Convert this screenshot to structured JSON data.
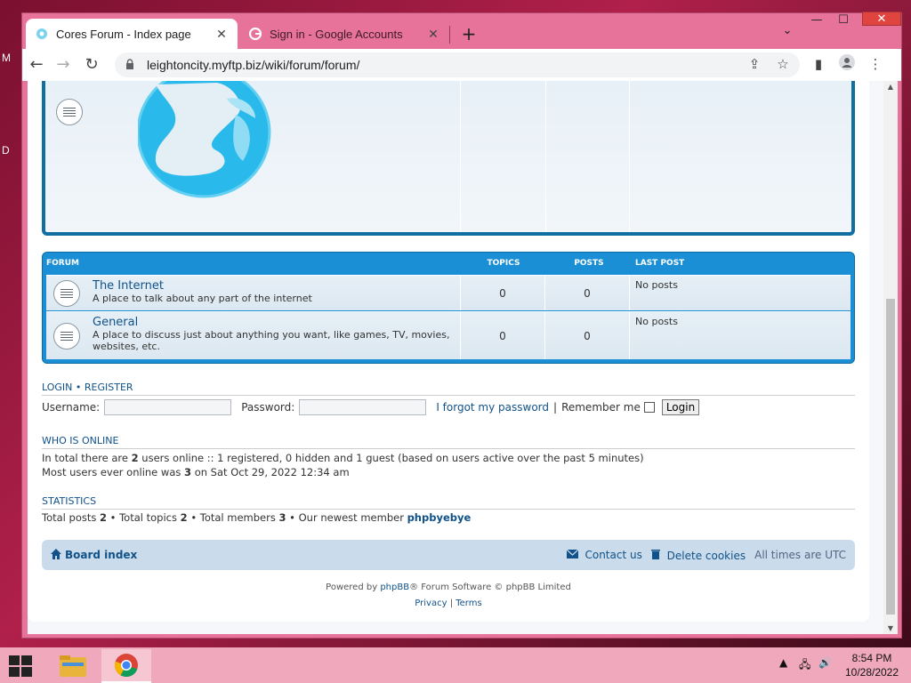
{
  "desktop": {
    "letter_top": "M",
    "letter_bottom": "D"
  },
  "browser": {
    "tabs": [
      {
        "title": "Cores Forum - Index page",
        "close": "✕"
      },
      {
        "title": "Sign in - Google Accounts",
        "close": "✕"
      }
    ],
    "new_tab": "+",
    "tab_menu": "⌄",
    "window_controls": {
      "minimize": "—",
      "maximize": "☐",
      "close": "✕"
    },
    "url": "leightoncity.myftp.biz/wiki/forum/forum/"
  },
  "forum": {
    "headers": {
      "forum": "Forum",
      "topics": "Topics",
      "posts": "Posts",
      "last_post": "Last post"
    },
    "rows": [
      {
        "name": "The Internet",
        "desc": "A place to talk about any part of the internet",
        "topics": "0",
        "posts": "0",
        "last": "No posts"
      },
      {
        "name": "General",
        "desc": "A place to discuss just about anything you want, like games, TV, movies, websites, etc.",
        "topics": "0",
        "posts": "0",
        "last": "No posts"
      }
    ]
  },
  "login": {
    "login_link": "Login",
    "separator": "•",
    "register_link": "Register",
    "username_label": "Username:",
    "password_label": "Password:",
    "forgot": "I forgot my password",
    "pipe": "|",
    "remember": "Remember me",
    "button": "Login"
  },
  "online": {
    "title": "Who is online",
    "line1_a": "In total there are",
    "line1_count": "2",
    "line1_b": "users online :: 1 registered, 0 hidden and 1 guest (based on users active over the past 5 minutes)",
    "line2_a": "Most users ever online was",
    "line2_count": "3",
    "line2_b": "on Sat Oct 29, 2022 12:34 am"
  },
  "stats": {
    "title": "Statistics",
    "posts_label": "Total posts",
    "posts": "2",
    "topics_label": "• Total topics",
    "topics": "2",
    "members_label": "• Total members",
    "members": "3",
    "newest_label": "• Our newest member",
    "newest": "phpbyebye"
  },
  "navbar": {
    "board_index": "Board index",
    "contact": "Contact us",
    "delete_cookies": "Delete cookies",
    "timezone": "All times are UTC"
  },
  "footer": {
    "powered_a": "Powered by",
    "phpbb": "phpBB",
    "powered_b": "® Forum Software © phpBB Limited",
    "privacy": "Privacy",
    "pipe": "|",
    "terms": "Terms"
  },
  "taskbar": {
    "time": "8:54 PM",
    "date": "10/28/2022"
  },
  "colors": {
    "accent": "#1a8fd6",
    "link": "#105289",
    "window_frame": "#e8739a",
    "taskbar": "#f0a8bd"
  }
}
